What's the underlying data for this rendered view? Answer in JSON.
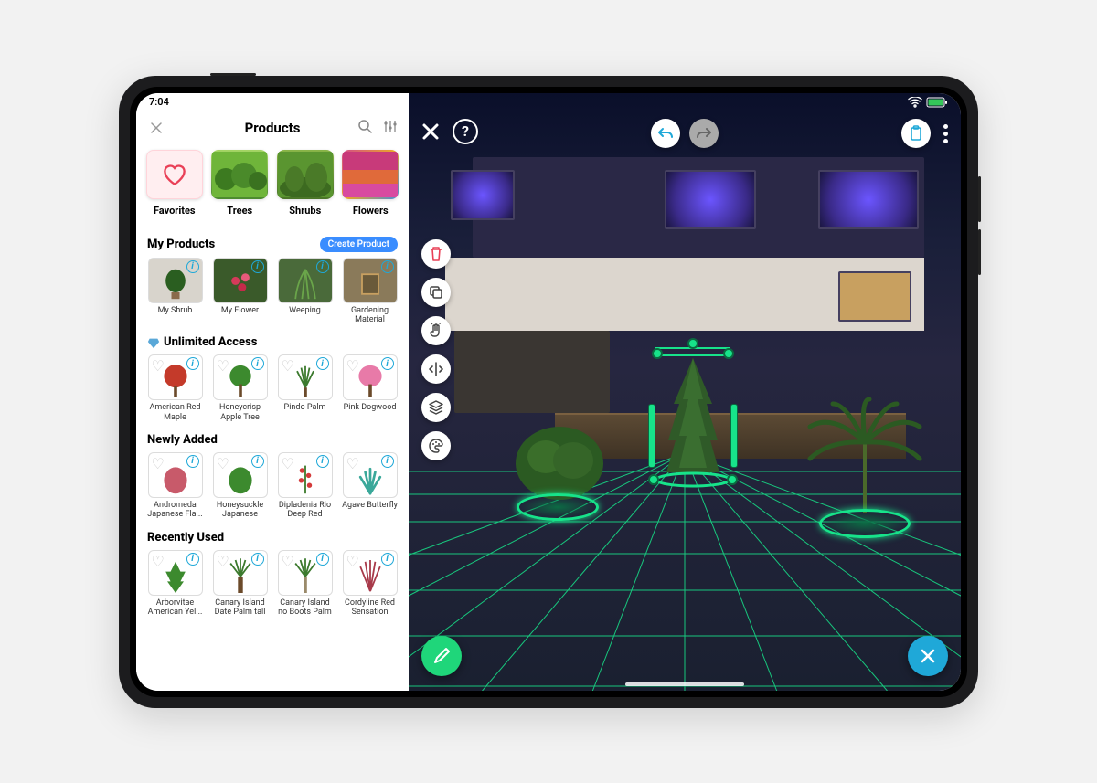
{
  "status": {
    "time": "7:04"
  },
  "sidebar": {
    "title": "Products",
    "categories": [
      {
        "label": "Favorites",
        "kind": "fav"
      },
      {
        "label": "Trees"
      },
      {
        "label": "Shrubs"
      },
      {
        "label": "Flowers"
      }
    ],
    "sections": {
      "my_products": {
        "title": "My Products",
        "action": "Create Product",
        "items": [
          {
            "label": "My Shrub"
          },
          {
            "label": "My Flower"
          },
          {
            "label": "Weeping"
          },
          {
            "label": "Gardening Material"
          }
        ]
      },
      "unlimited": {
        "title": "Unlimited Access",
        "items": [
          {
            "label": "American Red Maple"
          },
          {
            "label": "Honeycrisp Apple Tree"
          },
          {
            "label": "Pindo Palm"
          },
          {
            "label": "Pink Dogwood"
          }
        ]
      },
      "newly_added": {
        "title": "Newly Added",
        "items": [
          {
            "label": "Andromeda Japanese Fla..."
          },
          {
            "label": "Honeysuckle Japanese"
          },
          {
            "label": "Dipladenia Rio Deep Red"
          },
          {
            "label": "Agave Butterfly"
          }
        ]
      },
      "recently_used": {
        "title": "Recently Used",
        "items": [
          {
            "label": "Arborvitae American Yel..."
          },
          {
            "label": "Canary Island Date Palm tall"
          },
          {
            "label": "Canary Island no Boots Palm"
          },
          {
            "label": "Cordyline Red Sensation"
          }
        ]
      }
    }
  },
  "colors": {
    "accent_blue": "#1fa8d8",
    "accent_green": "#1fd67a",
    "selection": "#17e38a",
    "pill_blue": "#3a8dff",
    "delete_red": "#e94057"
  }
}
